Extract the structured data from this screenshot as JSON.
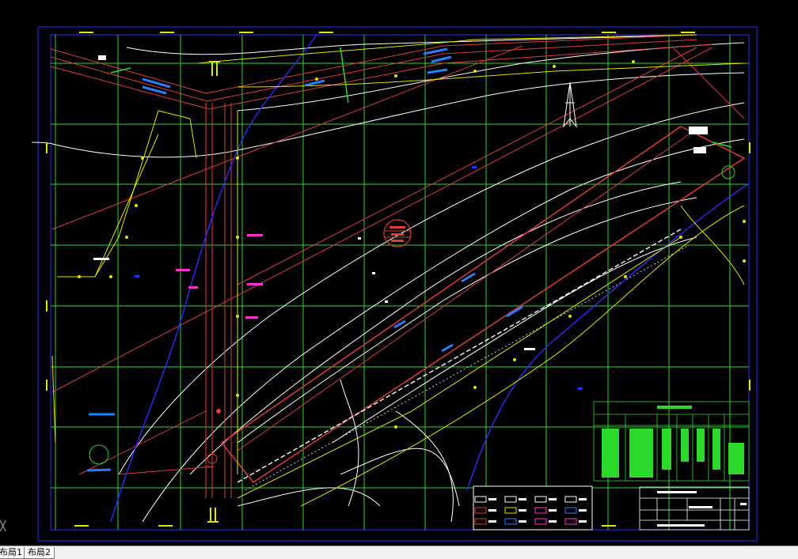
{
  "tabs": [
    {
      "label": "布局1"
    },
    {
      "label": "布局2"
    }
  ],
  "drawing": {
    "seal_text": [
      "...",
      "...",
      "..."
    ],
    "map_labels": [
      "...",
      "...",
      "..."
    ],
    "table_title": "...",
    "title_block": [
      "...",
      "..."
    ]
  },
  "colors": {
    "background": "#000000",
    "grid": "#2bd92b",
    "frame": "#2b2bff",
    "road_red": "#e03a3a",
    "contour": "#ffffff",
    "yellow": "#e6e600",
    "blue": "#2b2bff",
    "magenta": "#ff33cc",
    "cyan": "#33aaff",
    "table_green": "#2bd92b",
    "tab_bg": "#f0f0f0"
  },
  "icons": [
    "north-arrow-icon",
    "ucs-axis-icon",
    "seal-icon"
  ]
}
